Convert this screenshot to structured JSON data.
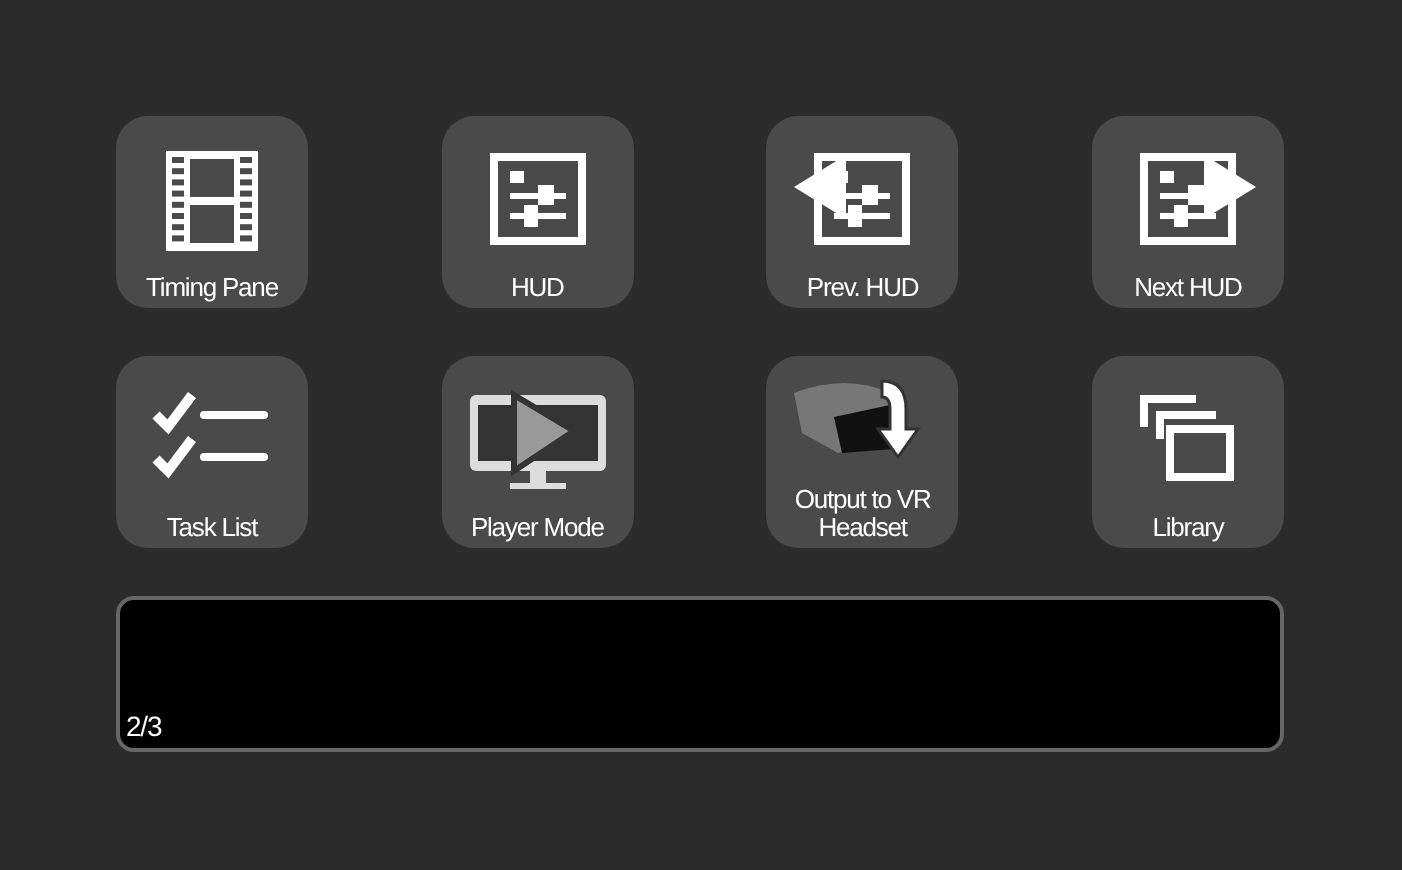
{
  "buttons": [
    {
      "kind": "film",
      "label": "Timing Pane"
    },
    {
      "kind": "hud",
      "label": "HUD"
    },
    {
      "kind": "prev-hud",
      "label": "Prev. HUD"
    },
    {
      "kind": "next-hud",
      "label": "Next HUD"
    },
    {
      "kind": "tasks",
      "label": "Task List"
    },
    {
      "kind": "player",
      "label": "Player Mode"
    },
    {
      "kind": "vr",
      "label": "Output to VR Headset"
    },
    {
      "kind": "library",
      "label": "Library"
    }
  ],
  "panel": {
    "page": "2/3"
  }
}
